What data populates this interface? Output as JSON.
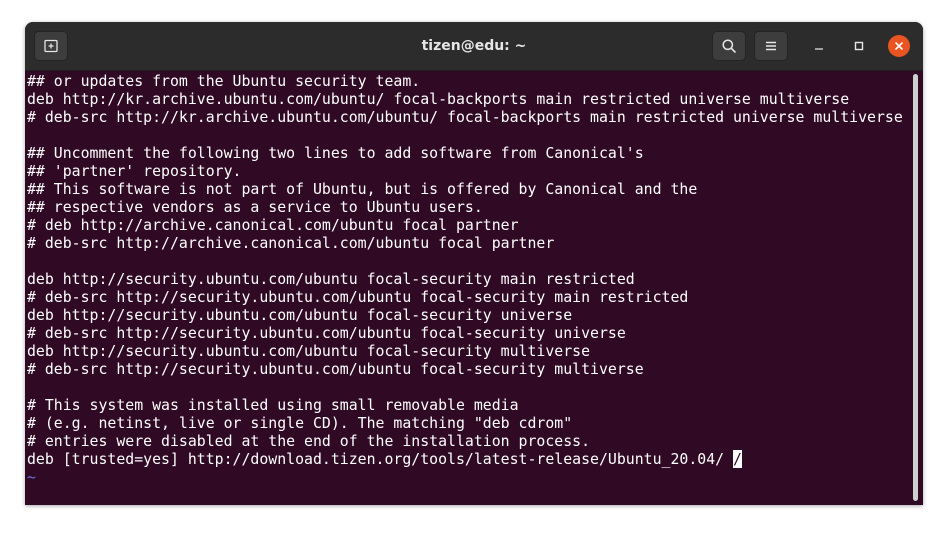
{
  "window": {
    "title": "tizen@edu: ~"
  },
  "icons": {
    "new_tab": "new-tab-icon",
    "search": "search-icon",
    "menu": "hamburger-menu-icon",
    "minimize": "minimize-icon",
    "maximize": "maximize-icon",
    "close": "close-icon"
  },
  "colors": {
    "terminal_background": "#300a24",
    "terminal_text": "#ffffff",
    "tilde": "#6f6fe0",
    "close_button": "#e95420",
    "titlebar": "#2c2c2c"
  },
  "terminal": {
    "lines": [
      "## or updates from the Ubuntu security team.",
      "deb http://kr.archive.ubuntu.com/ubuntu/ focal-backports main restricted universe multiverse",
      "# deb-src http://kr.archive.ubuntu.com/ubuntu/ focal-backports main restricted universe multiverse",
      "",
      "## Uncomment the following two lines to add software from Canonical's",
      "## 'partner' repository.",
      "## This software is not part of Ubuntu, but is offered by Canonical and the",
      "## respective vendors as a service to Ubuntu users.",
      "# deb http://archive.canonical.com/ubuntu focal partner",
      "# deb-src http://archive.canonical.com/ubuntu focal partner",
      "",
      "deb http://security.ubuntu.com/ubuntu focal-security main restricted",
      "# deb-src http://security.ubuntu.com/ubuntu focal-security main restricted",
      "deb http://security.ubuntu.com/ubuntu focal-security universe",
      "# deb-src http://security.ubuntu.com/ubuntu focal-security universe",
      "deb http://security.ubuntu.com/ubuntu focal-security multiverse",
      "# deb-src http://security.ubuntu.com/ubuntu focal-security multiverse",
      "",
      "# This system was installed using small removable media",
      "# (e.g. netinst, live or single CD). The matching \"deb cdrom\"",
      "# entries were disabled at the end of the installation process.",
      "deb [trusted=yes] http://download.tizen.org/tools/latest-release/Ubuntu_20.04/ "
    ],
    "cursor_char": "/",
    "tilde_lines": [
      "~"
    ]
  }
}
